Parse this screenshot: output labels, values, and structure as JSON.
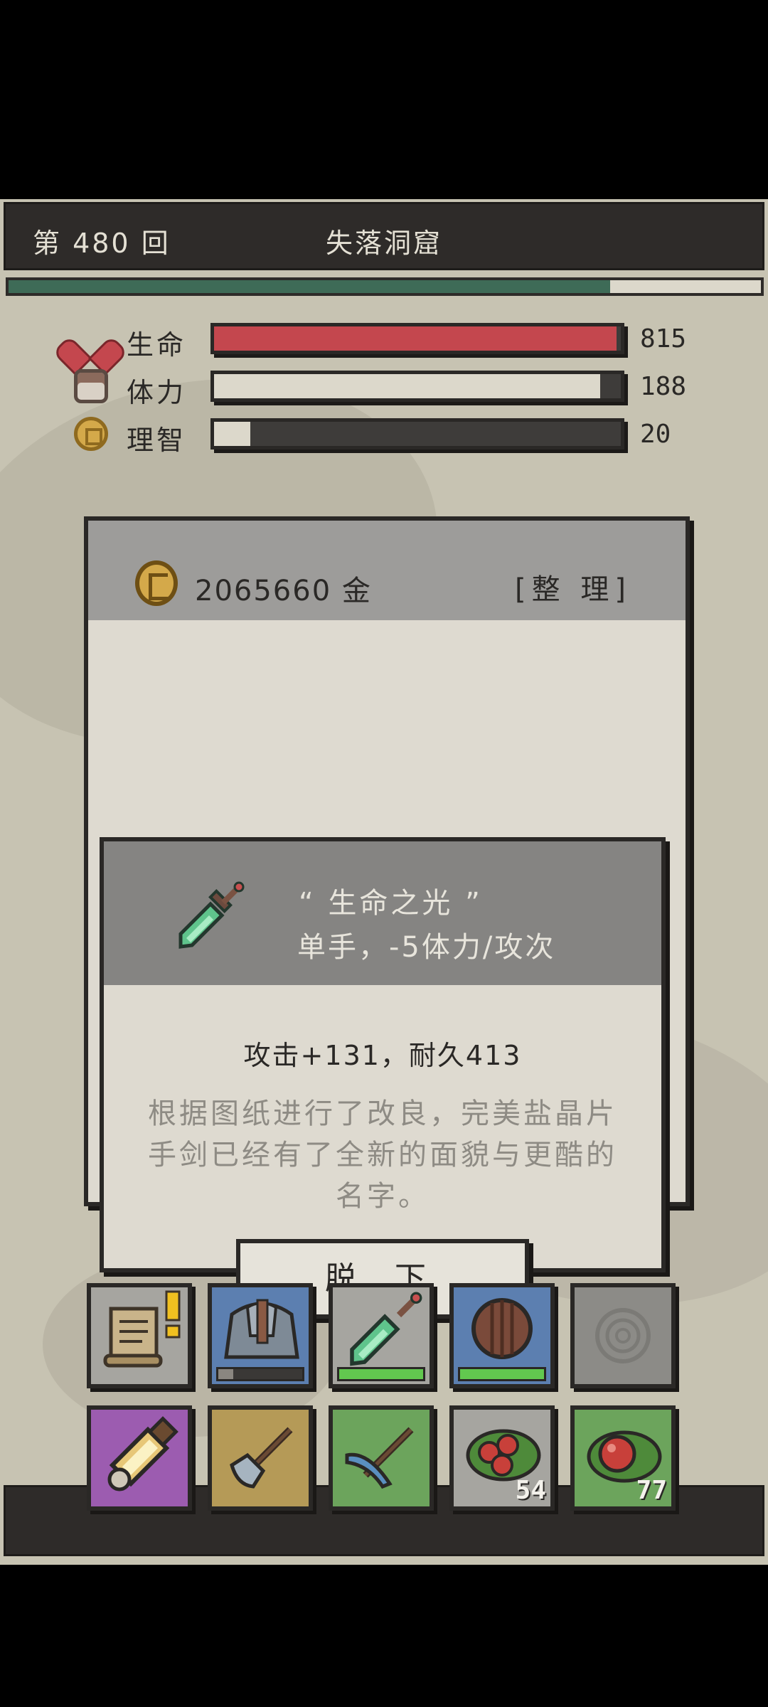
{
  "header": {
    "round": "第 480 回",
    "location": "失落洞窟",
    "progress_pct": 80
  },
  "stats": [
    {
      "label": "生命",
      "value": "815",
      "fill_pct": 99,
      "icon": "heart-icon",
      "color": "#c4474e"
    },
    {
      "label": "体力",
      "value": "188",
      "fill_pct": 95,
      "icon": "stamina-icon",
      "color": "#dcd8cb"
    },
    {
      "label": "理智",
      "value": "20",
      "fill_pct": 9,
      "icon": "sanity-icon",
      "color": "#dcd8cb"
    }
  ],
  "inventory": {
    "gold": "2065660 金",
    "organize": "[整 理]"
  },
  "item": {
    "name": "“ 生命之光 ”",
    "type": "单手，-5体力/攻次",
    "stats": "攻击+131，耐久413",
    "description": "根据图纸进行了改良，完美盐晶片手剑已经有了全新的面貌与更酷的名字。",
    "unequip": "脱 下"
  },
  "slots_row1": [
    {
      "name": "quest-scroll",
      "icon": "scroll-icon",
      "bg": "#a6a5a0",
      "alert": true
    },
    {
      "name": "armor",
      "icon": "armor-icon",
      "bg": "#5c7fb0",
      "durability_pct": 18,
      "dur_color": "#8a8680"
    },
    {
      "name": "weapon",
      "icon": "sword-icon",
      "bg": "#a6a5a0",
      "durability_pct": 100,
      "dur_color": "#62c84f"
    },
    {
      "name": "shield",
      "icon": "shield-icon",
      "bg": "#5c7fb0",
      "durability_pct": 100,
      "dur_color": "#62c84f"
    },
    {
      "name": "accessory-empty",
      "icon": "ring-placeholder-icon",
      "bg": "#8c8b87"
    }
  ],
  "slots_row2": [
    {
      "name": "lantern",
      "icon": "lantern-icon",
      "bg": "#9c5cb0"
    },
    {
      "name": "axe",
      "icon": "axe-icon",
      "bg": "#b59a57"
    },
    {
      "name": "pickaxe",
      "icon": "pickaxe-icon",
      "bg": "#6ca45c"
    },
    {
      "name": "berries",
      "icon": "berries-icon",
      "bg": "#a6a5a0",
      "count": "54"
    },
    {
      "name": "apple",
      "icon": "apple-icon",
      "bg": "#6ca45c",
      "count": "77"
    }
  ]
}
